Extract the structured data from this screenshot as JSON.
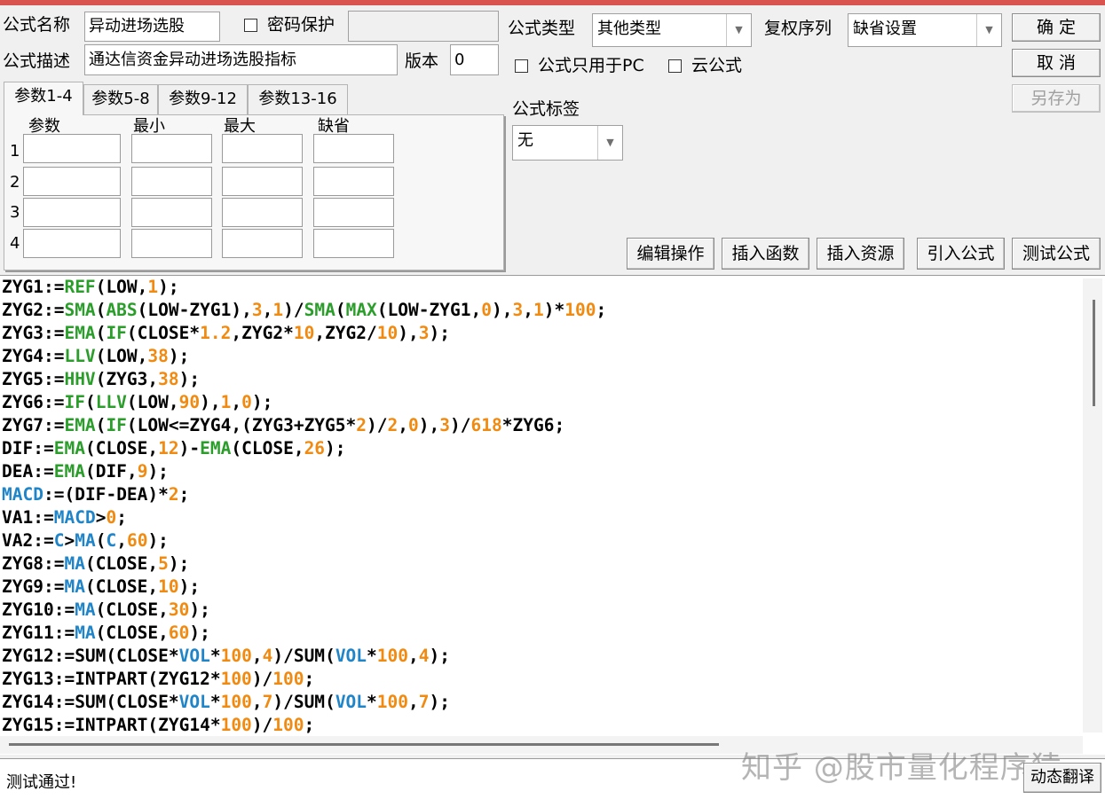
{
  "form": {
    "name_label": "公式名称",
    "name_value": "异动进场选股",
    "password_label": "密码保护",
    "desc_label": "公式描述",
    "desc_value": "通达信资金异动进场选股指标",
    "version_label": "版本",
    "version_value": "0",
    "type_label": "公式类型",
    "type_value": "其他类型",
    "rights_label": "复权序列",
    "rights_value": "缺省设置",
    "pc_only_label": "公式只用于PC",
    "cloud_label": "云公式",
    "tag_label": "公式标签",
    "tag_value": "无"
  },
  "buttons": {
    "ok": "确  定",
    "cancel": "取  消",
    "save_as": "另存为",
    "edit_ops": "编辑操作",
    "insert_func": "插入函数",
    "insert_res": "插入资源",
    "import_formula": "引入公式",
    "test_formula": "测试公式",
    "dynamic_translate": "动态翻译"
  },
  "tabs": [
    "参数1-4",
    "参数5-8",
    "参数9-12",
    "参数13-16"
  ],
  "params": {
    "headers": [
      "参数",
      "最小",
      "最大",
      "缺省"
    ],
    "rows": [
      "1",
      "2",
      "3",
      "4"
    ]
  },
  "code_lines": [
    "ZYG1:=REF(LOW,1);",
    "ZYG2:=SMA(ABS(LOW-ZYG1),3,1)/SMA(MAX(LOW-ZYG1,0),3,1)*100;",
    "ZYG3:=EMA(IF(CLOSE*1.2,ZYG2*10,ZYG2/10),3);",
    "ZYG4:=LLV(LOW,38);",
    "ZYG5:=HHV(ZYG3,38);",
    "ZYG6:=IF(LLV(LOW,90),1,0);",
    "ZYG7:=EMA(IF(LOW<=ZYG4,(ZYG3+ZYG5*2)/2,0),3)/618*ZYG6;",
    "DIF:=EMA(CLOSE,12)-EMA(CLOSE,26);",
    "DEA:=EMA(DIF,9);",
    "MACD:=(DIF-DEA)*2;",
    "VA1:=MACD>0;",
    "VA2:=C>MA(C,60);",
    "ZYG8:=MA(CLOSE,5);",
    "ZYG9:=MA(CLOSE,10);",
    "ZYG10:=MA(CLOSE,30);",
    "ZYG11:=MA(CLOSE,60);",
    "ZYG12:=SUM(CLOSE*VOL*100,4)/SUM(VOL*100,4);",
    "ZYG13:=INTPART(ZYG12*100)/100;",
    "ZYG14:=SUM(CLOSE*VOL*100,7)/SUM(VOL*100,7);",
    "ZYG15:=INTPART(ZYG14*100)/100;"
  ],
  "status_text": "测试通过!",
  "watermark": "知乎 @股市量化程序猿",
  "colors": {
    "function": "#2a9d2a",
    "builtin": "#1f84c8",
    "number": "#f08a10",
    "title_bar": "#d9534f"
  }
}
